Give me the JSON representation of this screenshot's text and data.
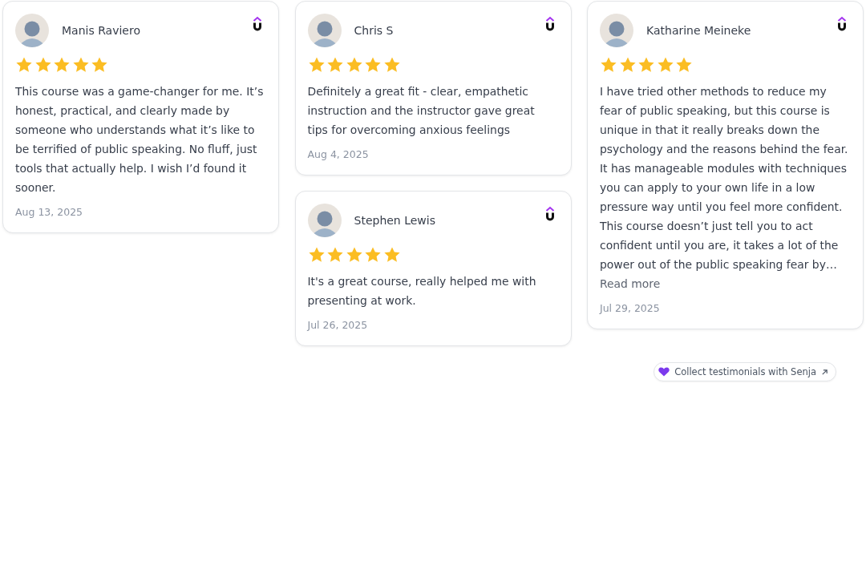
{
  "columns": [
    {
      "reviews": [
        {
          "name": "Manis Raviero",
          "stars": 5,
          "text": "This course was a game-changer for me. It’s honest, practical, and clearly made by someone who understands what it’s like to be terrified of public speaking. No fluff, just tools that actually help. I wish I’d found it sooner.",
          "date": "Aug 13, 2025"
        }
      ]
    },
    {
      "reviews": [
        {
          "name": "Chris S",
          "stars": 5,
          "text": "Definitely a great fit - clear, empathetic instruction and the instructor gave great tips for overcoming anxious feelings",
          "date": "Aug 4, 2025"
        },
        {
          "name": "Stephen Lewis",
          "stars": 5,
          "text": "It's a great course, really helped me with presenting at work.",
          "date": "Jul 26, 2025"
        }
      ]
    },
    {
      "reviews": [
        {
          "name": "Katharine Meineke",
          "stars": 5,
          "text": "I have tried other methods to reduce my fear of public speaking, but this course is unique in that it really breaks down the psychology and the reasons behind the fear. It has manageable modules with techniques you can apply to your own life in a low pressure way until you feel more confident. This course doesn’t just tell you to act confident until you are, it takes a lot of the power out of the public speaking fear by…",
          "read_more": "Read more",
          "date": "Jul 29, 2025"
        }
      ]
    }
  ],
  "badge": {
    "label": "Collect testimonials with Senja"
  }
}
